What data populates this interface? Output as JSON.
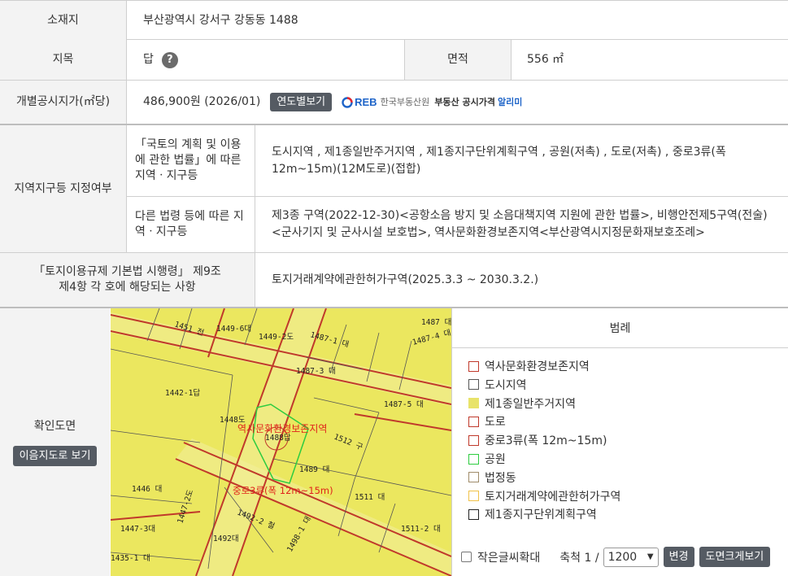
{
  "rows": {
    "location": {
      "label": "소재지",
      "value": "부산광역시 강서구 강동동 1488"
    },
    "land_category": {
      "label": "지목",
      "value": "답",
      "help_icon": "?"
    },
    "area": {
      "label": "면적",
      "value": "556 ㎡"
    },
    "price": {
      "label": "개별공시지가(㎡당)",
      "value": "486,900원 (2026/01)",
      "button": "연도별보기",
      "logo_mark": "REB",
      "logo_org": "한국부동산원",
      "logo_service": "부동산 공시가격",
      "logo_service_accent": "알리미"
    },
    "zone": {
      "label": "지역지구등 지정여부",
      "sub1_label": "「국토의 계획 및 이용 에 관한 법률」에 따른 지역ㆍ지구등",
      "sub1_value": "도시지역 , 제1종일반주거지역 , 제1종지구단위계획구역 , 공원(저촉) , 도로(저촉) , 중로3류(폭 12m~15m)(12M도로)(접합)",
      "sub2_label": "다른 법령 등에 따른 지역ㆍ지구등",
      "sub2_value": "제3종 구역(2022-12-30)<공항소음 방지 및 소음대책지역 지원에 관한 법률>, 비행안전제5구역(전술)<군사기지 및 군사시설 보호법>, 역사문화환경보존지역<부산광역시지정문화재보호조례>"
    },
    "regulation": {
      "label": "「토지이용규제 기본법 시행령」 제9조 제4항 각 호에 해당되는 사항",
      "value": "토지거래계약에관한허가구역(2025.3.3 ~ 2030.3.2.)"
    },
    "map": {
      "label": "확인도면",
      "button": "이음지도로 보기"
    }
  },
  "map_labels": {
    "p1451": "1451 전",
    "p1449_6": "1449-6대",
    "p1449_2": "1449-2도",
    "p1487_1": "1487-1 대",
    "p1487": "1487 대",
    "p1487_4": "1487-4 대",
    "p1487_3": "1487-3 대",
    "p1442_1": "1442-1답",
    "p1487_5": "1487-5 대",
    "p1448": "1448도",
    "p1488": "1488답",
    "p1512": "1512 구",
    "p1489": "1489 대",
    "p1446": "1446 대",
    "p1511": "1511 대",
    "p1447_2": "1447-2도",
    "p1447_3": "1447-3대",
    "p1492_2": "1492-2 철",
    "p1511_2": "1511-2 대",
    "p1492": "1492대",
    "p1435_1": "1435-1 대",
    "p1498_1": "1498-1 대",
    "overlay_history": "역사문화환경보존지역",
    "overlay_road": "중로3류(폭 12m~15m)"
  },
  "legend": {
    "title": "범례",
    "items": [
      {
        "label": "역사문화환경보존지역",
        "border": "#c0392b",
        "fill": "#ffffff"
      },
      {
        "label": "도시지역",
        "border": "#555555",
        "fill": "#ffffff"
      },
      {
        "label": "제1종일반주거지역",
        "border": "#e8e36a",
        "fill": "#e8e36a"
      },
      {
        "label": "도로",
        "border": "#c0392b",
        "fill": "#ffffff"
      },
      {
        "label": "중로3류(폭 12m~15m)",
        "border": "#c0392b",
        "fill": "#ffffff"
      },
      {
        "label": "공원",
        "border": "#2ecc40",
        "fill": "#ffffff"
      },
      {
        "label": "법정동",
        "border": "#a08c6a",
        "fill": "#ffffff"
      },
      {
        "label": "토지거래계약에관한허가구역",
        "border": "#f0c24a",
        "fill": "#ffffff"
      },
      {
        "label": "제1종지구단위계획구역",
        "border": "#222222",
        "fill": "#ffffff"
      }
    ]
  },
  "controls": {
    "small_text_label": "작은글씨확대",
    "scale_label": "축척 1 /",
    "scale_value": "1200",
    "change_button": "변경",
    "enlarge_button": "도면크게보기"
  },
  "colors": {
    "map_fill": "#ebe75f",
    "parcel_line": "#c0392b",
    "button_bg": "#555b63"
  }
}
